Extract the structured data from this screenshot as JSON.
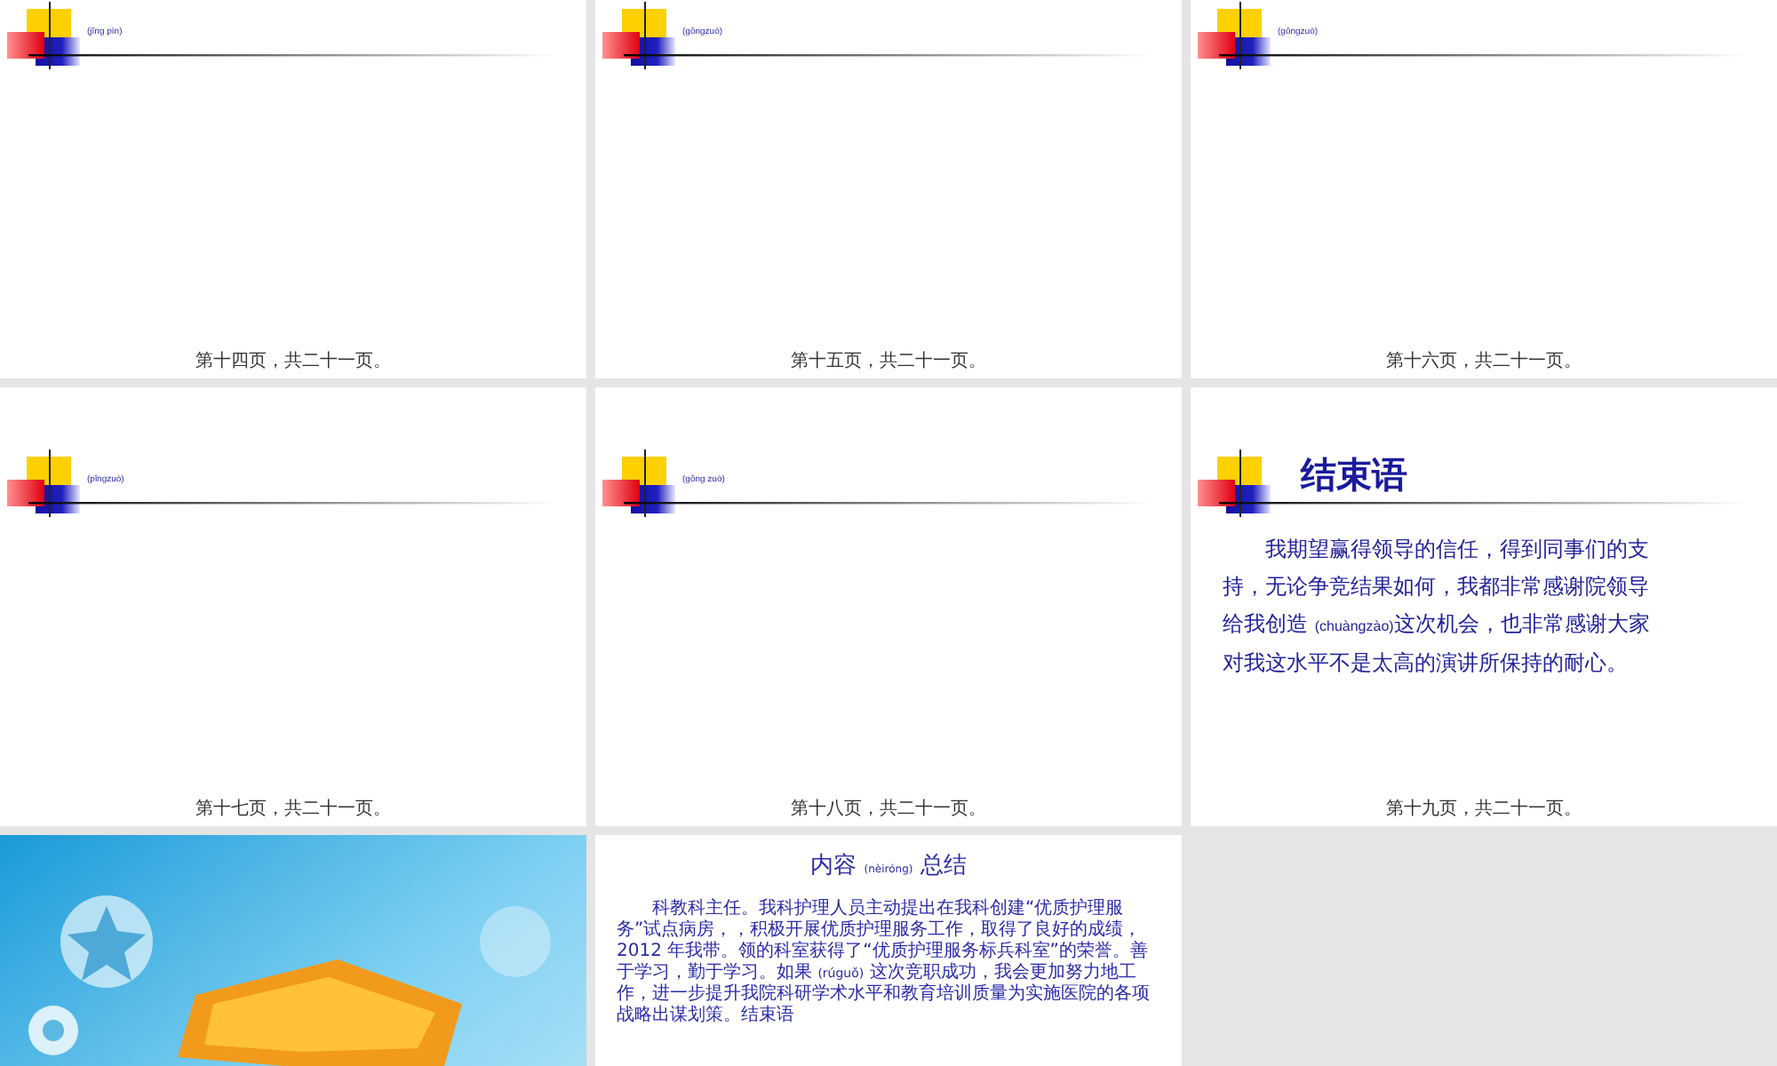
{
  "slides": [
    {
      "kind": "content",
      "title": "(jīng pìn)",
      "footer": "第十四页，共二十一页。"
    },
    {
      "kind": "content",
      "title": "(gōngzuò)",
      "footer": "第十五页，共二十一页。"
    },
    {
      "kind": "content",
      "title": "(gōngzuò)",
      "footer": "第十六页，共二十一页。"
    },
    {
      "kind": "content",
      "title": "(pǐngzuò)",
      "footer": "第十七页，共二十一页。"
    },
    {
      "kind": "content",
      "title": "(gōng zuò)",
      "footer": "第十八页，共二十一页。"
    },
    {
      "kind": "closing",
      "title": "结束语",
      "body": [
        {
          "kind": "text",
          "text": "我期望赢得领导的信任，得到同事们的支持，无论争竞结果如何，我都非常感谢院领导给我创造 "
        },
        {
          "kind": "pinyin",
          "text": "(chuàngzào)"
        },
        {
          "kind": "text",
          "text": "这次机会，也非常感谢大家对我这水平不是太高的演讲所保持的耐心。"
        }
      ],
      "footer": "第十九页，共二十一页。"
    },
    {
      "kind": "picture"
    },
    {
      "kind": "summary",
      "title": [
        {
          "kind": "text",
          "text": "内容 "
        },
        {
          "kind": "pinyin",
          "text": "(nèiróng)"
        },
        {
          "kind": "text",
          "text": " 总结"
        }
      ],
      "body": [
        {
          "kind": "text",
          "text": "科教科主任。我科护理人员主动提出在我科创建“优质护理服务”试点病房，，积极开展优质护理服务工作，取得了良好的成绩， 2012 年我带。领的科室获得了“优质护理服务标兵科室”的荣誉。善于学习，勤于学习。如果 "
        },
        {
          "kind": "pinyin",
          "text": "(rúguǒ)"
        },
        {
          "kind": "text",
          "text": " 这次竞职成功，我会更加努力地工作，进一步提升我院科研学术水平和教育培训质量为实施医院的各项战略出谋划策。结束语"
        }
      ]
    },
    {
      "kind": "empty"
    }
  ]
}
